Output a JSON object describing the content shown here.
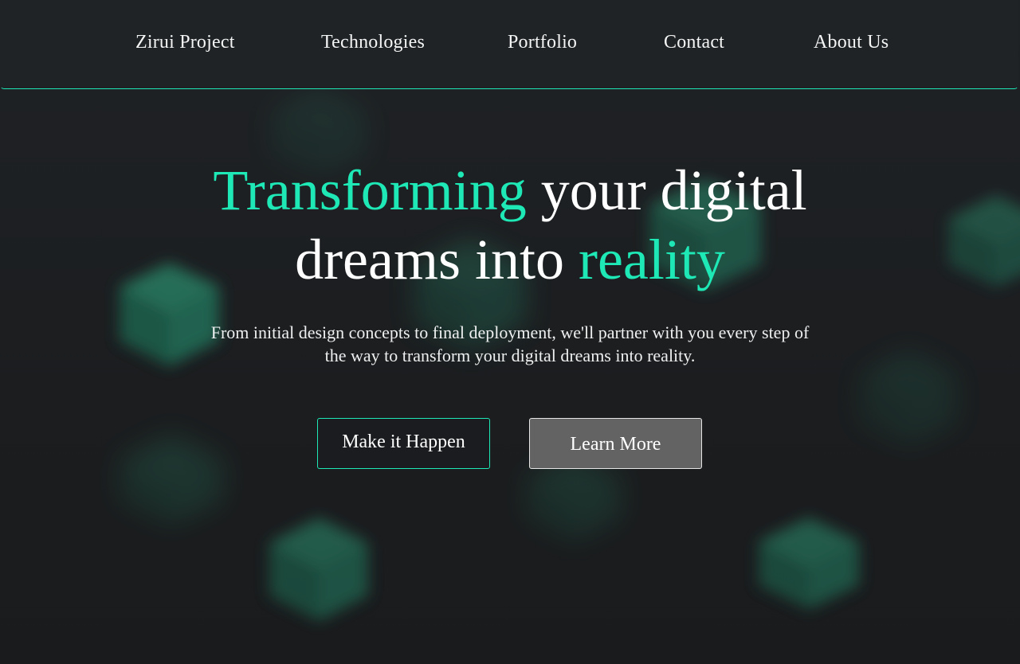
{
  "nav": {
    "items": [
      {
        "label": "Zirui Project"
      },
      {
        "label": "Technologies"
      },
      {
        "label": "Portfolio"
      },
      {
        "label": "Contact"
      },
      {
        "label": "About Us"
      }
    ]
  },
  "hero": {
    "headline": {
      "accent_1": "Transforming",
      "part_1": " your digital",
      "part_2": "dreams into ",
      "accent_2": "reality"
    },
    "subtext": "From initial design concepts to final deployment, we'll partner with you every step of the way to transform your digital dreams into reality.",
    "primary_button": "Make it Happen",
    "secondary_button": "Learn More"
  },
  "colors": {
    "accent": "#1ee8b6",
    "background": "#1b1d1f",
    "navbar": "#202326",
    "secondary_button": "#636363"
  },
  "decorations": {
    "background_icon": "blurred-cube-icon"
  }
}
